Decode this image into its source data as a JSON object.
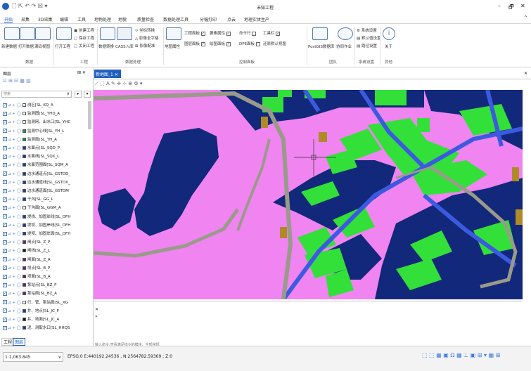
{
  "app": {
    "title": "未知工程",
    "window_controls": [
      "–",
      "🗗",
      "✕"
    ],
    "quick_icons": [
      "app-logo-icon",
      "new-icon",
      "select-icon",
      "undo-icon",
      "redo-icon",
      "extra-icon"
    ]
  },
  "tabs": [
    "开始",
    "采集",
    "3D采集",
    "编辑",
    "工具",
    "地物处理",
    "地貌",
    "质量检查",
    "数据处理工具",
    "分幅打印",
    "点云",
    "地理实体生产"
  ],
  "ribbon": {
    "buttons_data": [
      "新建数据",
      "打开数据",
      "满码视图"
    ],
    "group_data": "数据",
    "project_small": [
      "创建工程",
      "保存工程",
      "关闭工程"
    ],
    "project_big": "打开工程",
    "group_project": "工程",
    "proc_big": [
      "数据转换",
      "CASS入库"
    ],
    "proc_small": [
      "坐标转换",
      "影像全字格",
      "影像配准"
    ],
    "group_proc": "数据处理",
    "ctrl_big": "地图属性",
    "ctrl_row1": [
      "工程面板",
      "要素属性",
      "命令行",
      "工具栏"
    ],
    "ctrl_row2": [
      "图层面板",
      "绘图面板",
      "DPE面板",
      "还原默认视图"
    ],
    "ctrl_checks": [
      true,
      true,
      false,
      true,
      false,
      true,
      false
    ],
    "group_ctrl": "控制面板",
    "team_big": [
      "PostGIS数据库",
      "协同作业"
    ],
    "group_team": "团队",
    "sys_small": [
      "系统设置",
      "默认值设置",
      "路径设置"
    ],
    "group_sys": "系统设置",
    "about": "关于",
    "group_about": "其他"
  },
  "layers_panel": {
    "title": "图层",
    "pin": "⊞ ✕",
    "search_placeholder": "搜索",
    "bottom_tabs": [
      "工程",
      "图层"
    ],
    "layers": [
      {
        "label": "测区[SL_KQ_A",
        "color": "#ffffff",
        "swatch": "#ffffff"
      },
      {
        "label": "监测图[SL_YHD_A",
        "color": "#ffffff",
        "swatch": "#ffffff"
      },
      {
        "label": "监测网、出水口[SL_YHC",
        "color": "#ffffff",
        "swatch": "#ffffff"
      },
      {
        "label": "监测中心线[SL_YH_L",
        "color": "#1a9e3a",
        "swatch": "#1a9e3a"
      },
      {
        "label": "监测面[SL_YH_A",
        "color": "#1a9e3a",
        "swatch": "#1a9e3a"
      },
      {
        "label": "水面点[SL_SQD_P",
        "color": "#1a9e3a",
        "swatch": "#1a3c9e"
      },
      {
        "label": "水面线[SL_SQX_L",
        "color": "#1a9e3a",
        "swatch": "#1a3c9e"
      },
      {
        "label": "水面范围面[SL_SQM_A",
        "color": "#1a9e3a",
        "swatch": "#1a3c9e"
      },
      {
        "label": "边水通道点[SL_GSTDD_",
        "color": "#1a9e3a",
        "swatch": "#1a3c9e"
      },
      {
        "label": "边水通道线[SL_GSTDX_",
        "color": "#1a9e3a",
        "swatch": "#1a3c9e"
      },
      {
        "label": "边水通道面[SL_GSTDM",
        "color": "#1a9e3a",
        "swatch": "#1a3c9e"
      },
      {
        "label": "干沟[SL_GG_L",
        "color": "#1a9e3a",
        "swatch": "#1a3c9e"
      },
      {
        "label": "干沟面[SL_GGM_A",
        "color": "#1a9e3a",
        "swatch": "#ffffff"
      },
      {
        "label": "堤线、加固岸线[SL_DFH",
        "color": "#1a9e3a",
        "swatch": "#1a3c9e"
      },
      {
        "label": "堤坝、加固岸线[SL_DFH",
        "color": "#1a9e3a",
        "swatch": "#1a3c9e"
      },
      {
        "label": "堤坝、加固岸面[SL_DFH",
        "color": "#1a9e3a",
        "swatch": "#1a3c9e"
      },
      {
        "label": "闸点[SL_Z_P",
        "color": "#1a9e3a",
        "swatch": "#6b2080"
      },
      {
        "label": "闸线[SL_Z_L",
        "color": "#1a9e3a",
        "swatch": "#1a1a1a"
      },
      {
        "label": "闸面[SL_Z_A",
        "color": "#1a9e3a",
        "swatch": "#6b2080"
      },
      {
        "label": "坝点[SL_B_P",
        "color": "#1a9e3a",
        "swatch": "#6b2080"
      },
      {
        "label": "坝面[SL_B_A",
        "color": "#1a9e3a",
        "swatch": "#6b2080"
      },
      {
        "label": "泵站点[SL_BZ_P",
        "color": "#1a9e3a",
        "swatch": "#6b2080"
      },
      {
        "label": "泵站面[SL_BZ_A",
        "color": "#1a9e3a",
        "swatch": "#6b2080"
      },
      {
        "label": "行、管、泵站面[SL_XG",
        "color": "#1a9e3a",
        "swatch": "#ffffff"
      },
      {
        "label": "井、地点[SL_JC_P",
        "color": "#1a9e3a",
        "swatch": "#1a3c9e"
      },
      {
        "label": "井、地面[SL_JC_A",
        "color": "#1a9e3a",
        "swatch": "#1a1a1a"
      },
      {
        "label": "泥、测取水口[SL_HHQS",
        "color": "#1a9e3a",
        "swatch": "#1a3c9e"
      }
    ]
  },
  "map": {
    "tab_label": "新地图_1",
    "tab_close": "✕",
    "pane_close": "✕",
    "toolbar_icons": "⟋ ⬚ A ✎ ✛ ⊹ ⊕ ⚙ ▾"
  },
  "command": {
    "close": "✕",
    "placeholder": "输入命令,查看满足指令的模块、全部常规"
  },
  "status": {
    "scale": "1:1,063.845",
    "coords": "EPSG:0  E:440192.24536 , N:2564782.59369 ; Z:0"
  },
  "colors": {
    "pink": "#f084f0",
    "navy": "#12287a",
    "green": "#33e03a",
    "blue": "#3c5ae0",
    "gray": "#9a9a8a",
    "brown": "#b08a28",
    "accent": "#1f5fbf"
  }
}
